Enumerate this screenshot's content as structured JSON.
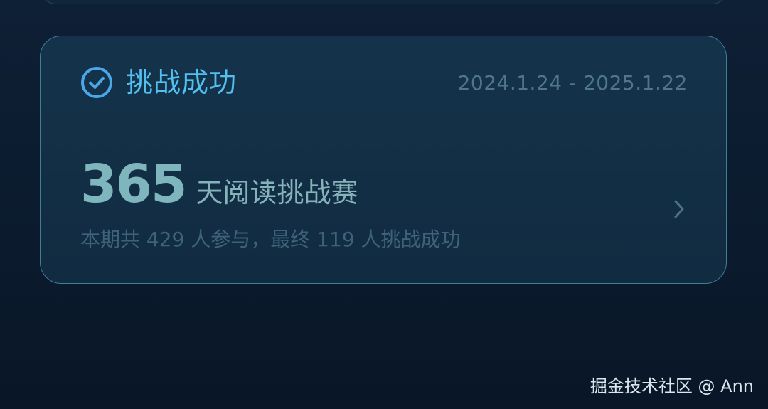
{
  "card": {
    "status": "挑战成功",
    "date_range": "2024.1.24 - 2025.1.22",
    "days": "365",
    "challenge_name": "天阅读挑战赛",
    "summary": "本期共 429 人参与，最终 119 人挑战成功"
  },
  "watermark": "掘金技术社区 @ Ann",
  "icons": {
    "status": "check-circle-icon",
    "navigate": "chevron-right-icon"
  },
  "colors": {
    "accent": "#52bff0",
    "number": "#7fb5bc",
    "card_border": "#3f7f96",
    "background": "#0c1c30"
  }
}
